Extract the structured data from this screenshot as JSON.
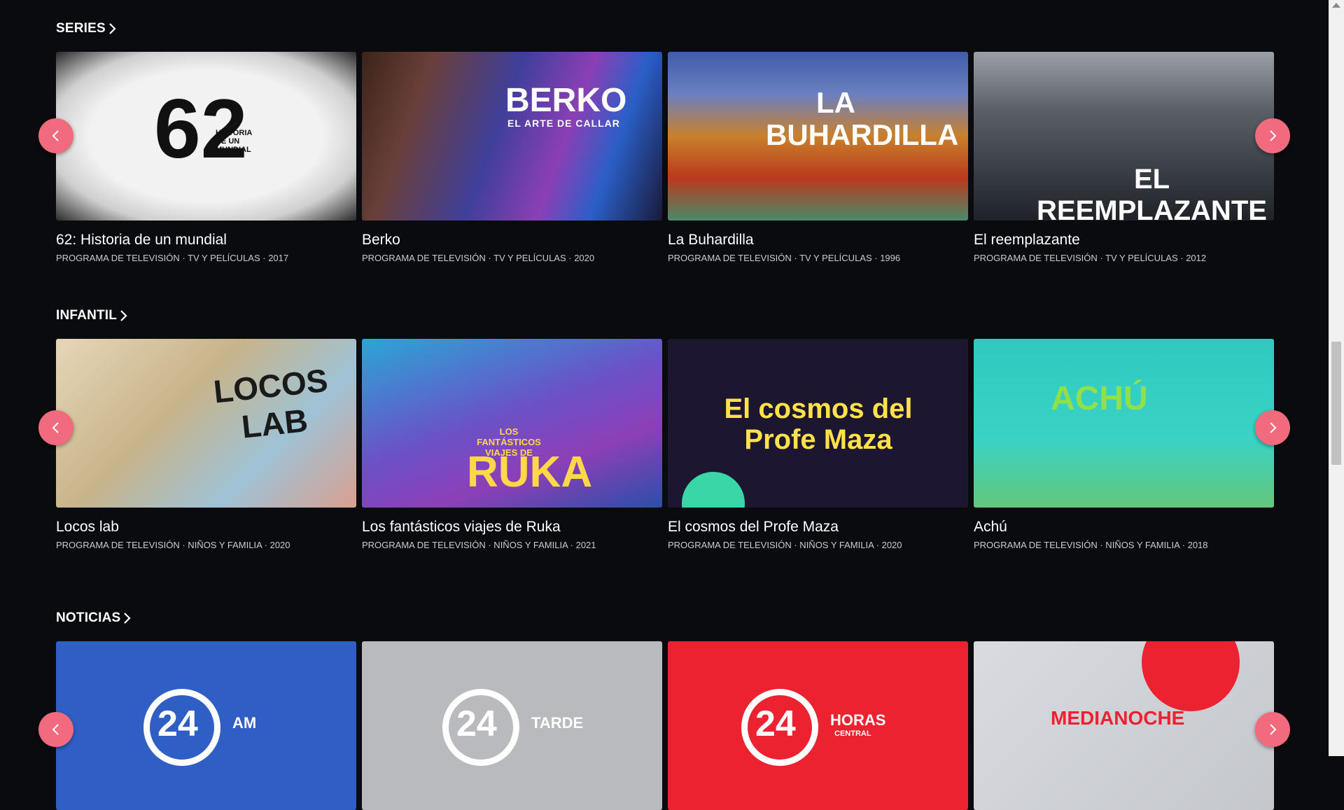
{
  "colors": {
    "background": "#0a0b0e",
    "arrow": "#f26a7e",
    "meta_text": "#c9cbd1"
  },
  "sections": [
    {
      "title": "SERIES",
      "cards": [
        {
          "thumb_text": "62",
          "thumb_sub": "HISTORIA DE UN MUNDIAL",
          "title": "62: Historia de un mundial",
          "meta": "PROGRAMA DE TELEVISIÓN · TV Y PELÍCULAS · 2017"
        },
        {
          "thumb_text": "BERKO",
          "thumb_sub": "EL ARTE DE CALLAR",
          "title": "Berko",
          "meta": "PROGRAMA DE TELEVISIÓN · TV Y PELÍCULAS · 2020"
        },
        {
          "thumb_text": "LA BUHARDILLA",
          "thumb_sub": "",
          "title": "La Buhardilla",
          "meta": "PROGRAMA DE TELEVISIÓN · TV Y PELÍCULAS · 1996"
        },
        {
          "thumb_text": "EL REEMPLAZANTE",
          "thumb_sub": "",
          "title": "El reemplazante",
          "meta": "PROGRAMA DE TELEVISIÓN · TV Y PELÍCULAS · 2012"
        }
      ]
    },
    {
      "title": "INFANTIL",
      "cards": [
        {
          "thumb_text": "LOCOS LAB",
          "thumb_sub": "",
          "title": "Locos lab",
          "meta": "PROGRAMA DE TELEVISIÓN · NIÑOS Y FAMILIA · 2020"
        },
        {
          "thumb_text": "RUKA",
          "thumb_sub": "LOS FANTÁSTICOS VIAJES DE",
          "title": "Los fantásticos viajes de Ruka",
          "meta": "PROGRAMA DE TELEVISIÓN · NIÑOS Y FAMILIA · 2021"
        },
        {
          "thumb_text": "El cosmos del Profe Maza",
          "thumb_sub": "",
          "title": "El cosmos del Profe Maza",
          "meta": "PROGRAMA DE TELEVISIÓN · NIÑOS Y FAMILIA · 2020"
        },
        {
          "thumb_text": "ACHÚ",
          "thumb_sub": "",
          "title": "Achú",
          "meta": "PROGRAMA DE TELEVISIÓN · NIÑOS Y FAMILIA · 2018"
        }
      ]
    },
    {
      "title": "NOTICIAS",
      "cards": [
        {
          "thumb_text": "24",
          "thumb_sub": "AM"
        },
        {
          "thumb_text": "24",
          "thumb_sub": "TARDE"
        },
        {
          "thumb_text": "24",
          "thumb_sub": "HORAS",
          "thumb_sub2": "CENTRAL"
        },
        {
          "thumb_text": "MEDIANOCHE",
          "thumb_sub": ""
        }
      ]
    }
  ],
  "icons": {
    "prev": "chevron-left-icon",
    "next": "chevron-right-icon",
    "section_more": "chevron-right-icon"
  }
}
